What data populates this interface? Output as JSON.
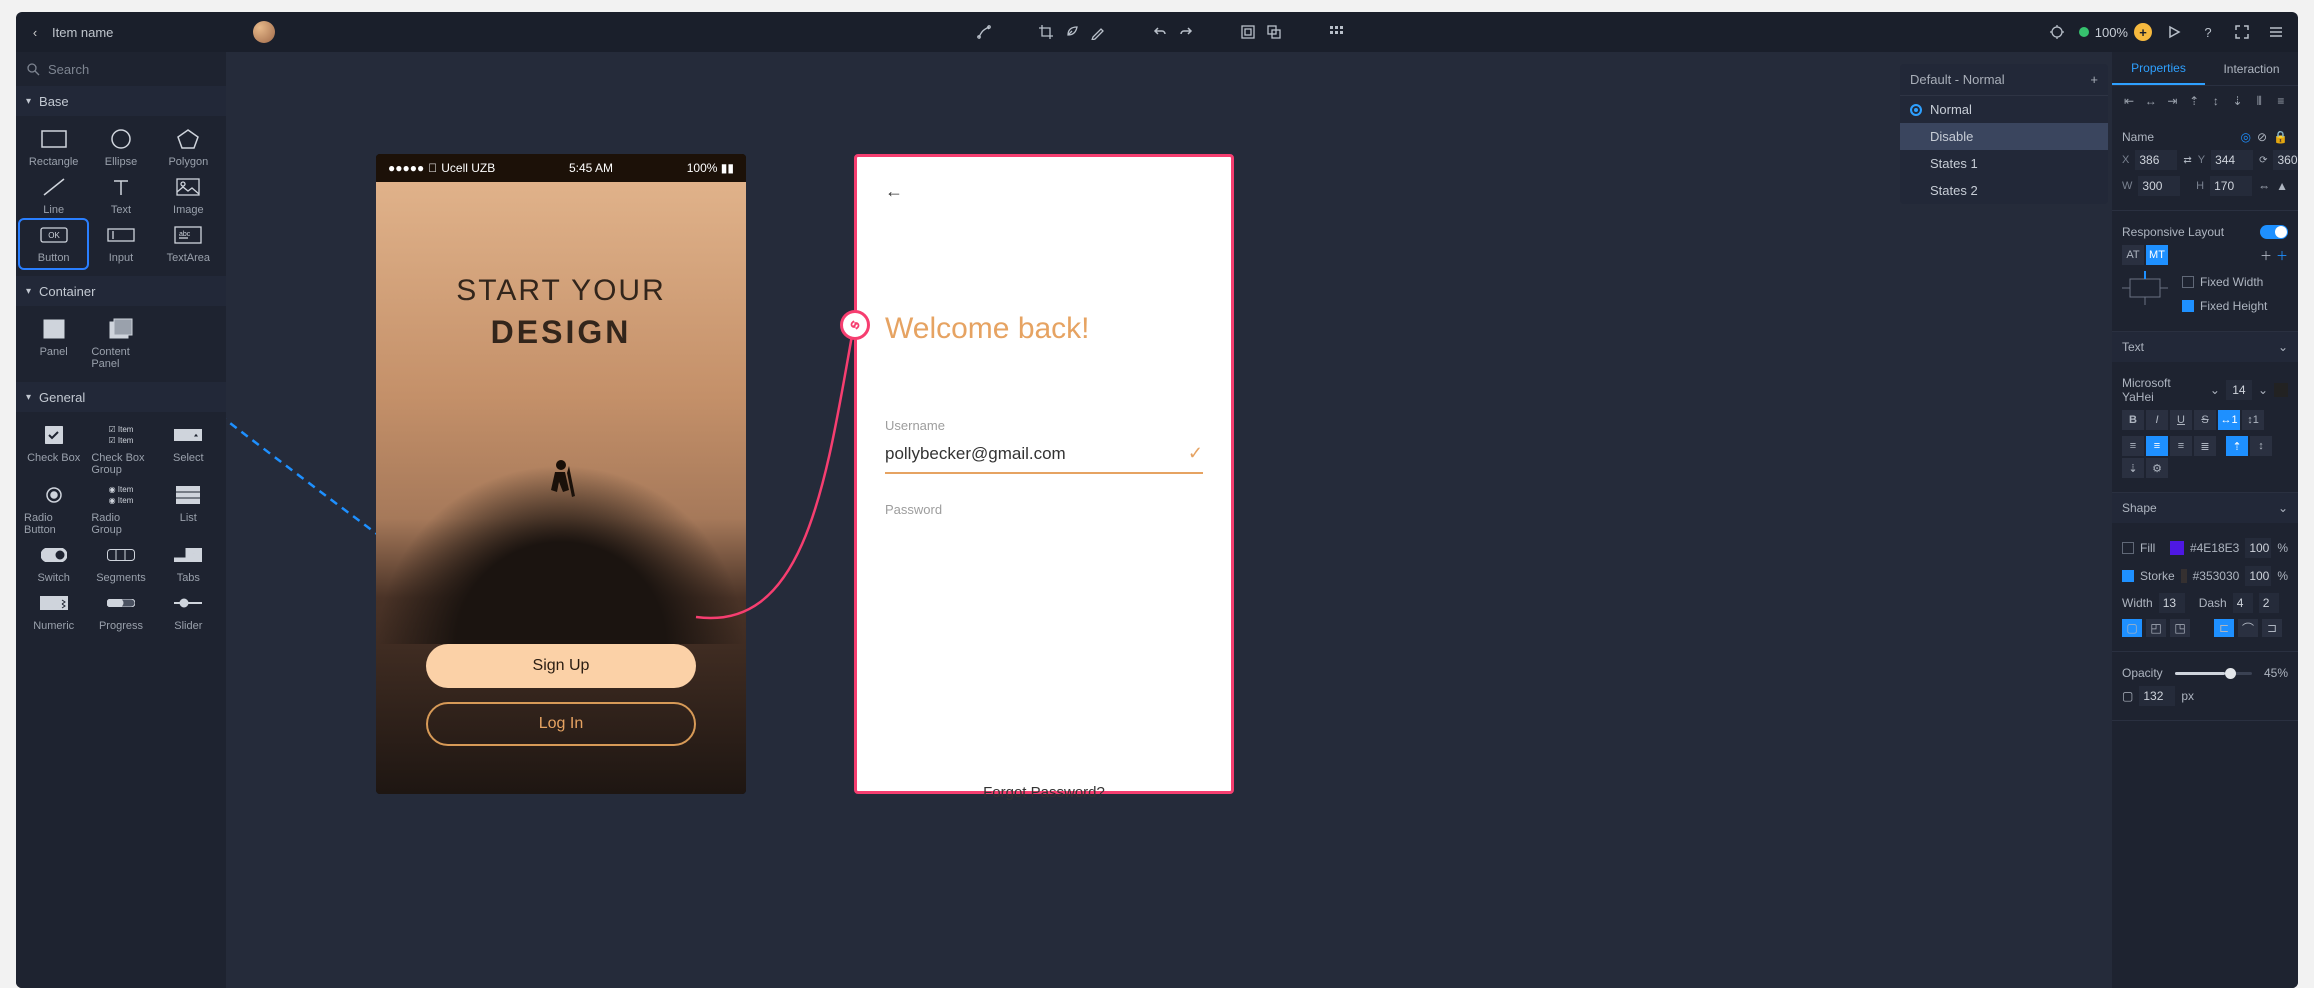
{
  "topbar": {
    "item_name": "Item name",
    "zoom": "100%"
  },
  "search": {
    "placeholder": "Search"
  },
  "categories": {
    "base": "Base",
    "container": "Container",
    "general": "General"
  },
  "shapes": {
    "rectangle": "Rectangle",
    "ellipse": "Ellipse",
    "polygon": "Polygon",
    "line": "Line",
    "text": "Text",
    "image": "Image",
    "button": "Button",
    "input": "Input",
    "textarea": "TextArea",
    "panel": "Panel",
    "content_panel": "Content Panel",
    "checkbox": "Check Box",
    "checkbox_group": "Check Box Group",
    "select": "Select",
    "radio": "Radio Button",
    "radio_group": "Radio Group",
    "list": "List",
    "switch": "Switch",
    "segments": "Segments",
    "tabs": "Tabs",
    "numeric": "Numeric",
    "progress": "Progress",
    "slider": "Slider",
    "item_label": "Item",
    "tab_label": "Tab"
  },
  "phone1": {
    "carrier": "Ucell UZB",
    "time": "5:45 AM",
    "battery": "100%",
    "title1": "START YOUR",
    "title2": "DESIGN",
    "signup": "Sign Up",
    "login": "Log In"
  },
  "phone2": {
    "welcome": "Welcome back!",
    "username_label": "Username",
    "username_value": "pollybecker@gmail.com",
    "password_label": "Password",
    "forgot": "Forgot Password?"
  },
  "states": {
    "header": "Default - Normal",
    "options": [
      "Normal",
      "Disable",
      "States 1",
      "States 2"
    ]
  },
  "props": {
    "tab_properties": "Properties",
    "tab_interaction": "Interaction",
    "name_label": "Name",
    "x": "386",
    "y": "344",
    "angle": "360°",
    "w": "300",
    "h": "170",
    "responsive": "Responsive Layout",
    "at": "AT",
    "mt": "MT",
    "fixed_width": "Fixed Width",
    "fixed_height": "Fixed Height",
    "text_section": "Text",
    "font": "Microsoft YaHei",
    "font_size": "14",
    "shape_section": "Shape",
    "fill_label": "Fill",
    "fill_hex": "#4E18E3",
    "fill_pct": "100",
    "pct": "%",
    "stroke_label": "Storke",
    "stroke_hex": "#353030",
    "stroke_pct": "100",
    "width_label": "Width",
    "width_val": "13",
    "dash_label": "Dash",
    "dash_a": "4",
    "dash_b": "2",
    "opacity_label": "Opacity",
    "opacity_val": "45%",
    "px": "132",
    "px_unit": "px"
  }
}
